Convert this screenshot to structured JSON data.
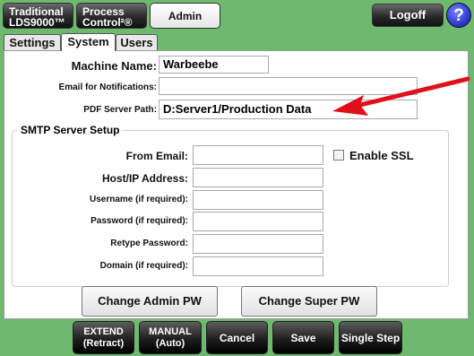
{
  "topnav": {
    "traditional_line1": "Traditional",
    "traditional_line2": "LDS9000™",
    "process_line1": "Process",
    "process_line2": "Control²®",
    "admin": "Admin",
    "logoff": "Logoff",
    "help": "?"
  },
  "tabs": [
    {
      "label": "Settings",
      "selected": false
    },
    {
      "label": "System",
      "selected": true
    },
    {
      "label": "Users",
      "selected": false
    }
  ],
  "form": {
    "machine_name_label": "Machine Name:",
    "machine_name_value": "Warbeebe",
    "email_label": "Email for Notifications:",
    "email_value": "",
    "pdf_path_label": "PDF Server Path:",
    "pdf_path_value": "D:Server1/Production Data"
  },
  "smtp": {
    "legend": "SMTP Server Setup",
    "from_email_label": "From Email:",
    "host_label": "Host/IP Address:",
    "username_label": "Username (if required):",
    "password_label": "Password (if required):",
    "retype_label": "Retype Password:",
    "domain_label": "Domain (if required):",
    "enable_ssl_label": "Enable SSL",
    "enable_ssl_checked": false
  },
  "buttons": {
    "change_admin": "Change Admin PW",
    "change_super": "Change Super PW"
  },
  "bottom": {
    "extend_line1": "EXTEND",
    "extend_line2": "(Retract)",
    "manual_line1": "MANUAL",
    "manual_line2": "(Auto)",
    "cancel": "Cancel",
    "save": "Save",
    "single_step": "Single Step"
  },
  "colors": {
    "background": "#6fb870",
    "arrow": "#e0101a",
    "help_button": "#2d3bd0"
  }
}
